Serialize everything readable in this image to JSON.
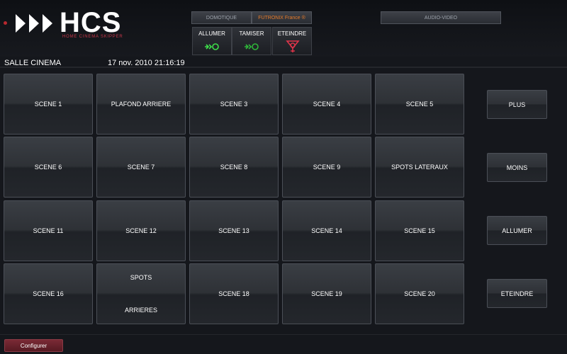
{
  "brand": {
    "name": "HCS",
    "subtitle": "HOME CINEMA SKIPPER",
    "accent_color": "#c9374a"
  },
  "tabs": [
    {
      "label": "DOMOTIQUE",
      "active": false
    },
    {
      "label": "FUTRONIX France ®",
      "active": true
    },
    {
      "label": "AUDIO-VIDEO",
      "active": false
    }
  ],
  "quick_actions": [
    {
      "label": "ALLUMER",
      "icon": "green-arrow-light-icon"
    },
    {
      "label": "TAMISER",
      "icon": "green-arrow-dim-icon"
    },
    {
      "label": "ETEINDRE",
      "icon": "red-off-icon"
    }
  ],
  "status": {
    "room": "SALLE CINEMA",
    "datetime": "17 nov. 2010  21:16:19"
  },
  "scenes": [
    [
      "SCENE 1",
      "PLAFOND ARRIERE",
      "SCENE 3",
      "SCENE 4",
      "SCENE 5"
    ],
    [
      "SCENE 6",
      "SCENE 7",
      "SCENE 8",
      "SCENE 9",
      "SPOTS LATERAUX"
    ],
    [
      "SCENE 11",
      "SCENE 12",
      "SCENE 13",
      "SCENE 14",
      "SCENE 15"
    ],
    [
      "SCENE 16",
      "SPOTS|ARRIERES",
      "SCENE 18",
      "SCENE 19",
      "SCENE 20"
    ]
  ],
  "side_controls": [
    "PLUS",
    "MOINS",
    "ALLUMER",
    "ETEINDRE"
  ],
  "footer": {
    "configure_label": "Configurer"
  }
}
